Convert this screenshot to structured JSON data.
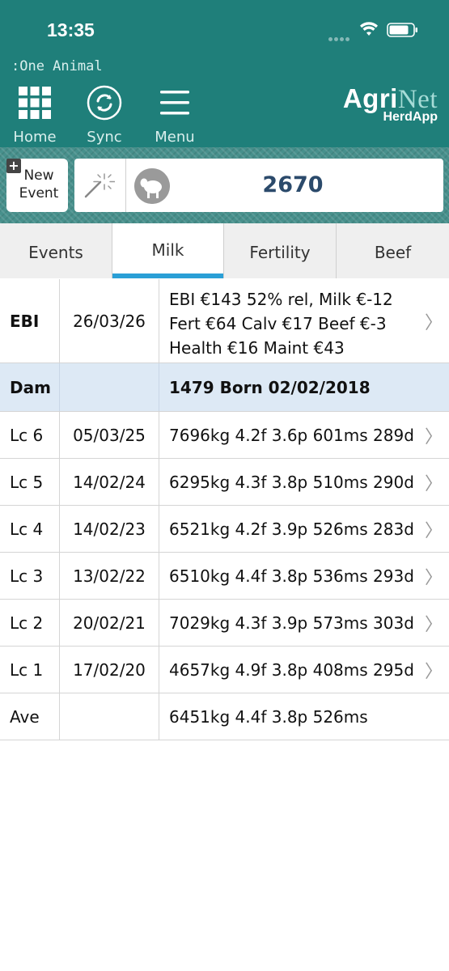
{
  "status": {
    "time": "13:35"
  },
  "screen_label": ":One Animal",
  "nav": {
    "home": "Home",
    "sync": "Sync",
    "menu": "Menu"
  },
  "brand": {
    "name_a": "Agri",
    "name_b": "Net",
    "sub": "HerdApp"
  },
  "toolbar": {
    "new_event_line1": "New",
    "new_event_line2": "Event",
    "animal_id": "2670"
  },
  "tabs": [
    "Events",
    "Milk",
    "Fertility",
    "Beef"
  ],
  "active_tab": "Milk",
  "colors": {
    "header": "#1f7f7a",
    "tab_indicator": "#2a9fd6",
    "dam_row": "#dde9f5",
    "animal_id": "#2b4a6b"
  },
  "ebi": {
    "label": "EBI",
    "date": "26/03/26",
    "line1": "EBI €143 52% rel, Milk €-12",
    "line2": "Fert €64 Calv €17 Beef €-3",
    "line3": "Health €16 Maint €43"
  },
  "dam": {
    "label": "Dam",
    "info": "1479 Born 02/02/2018"
  },
  "lactations": [
    {
      "label": "Lc 6",
      "date": "05/03/25",
      "summary": "7696kg 4.2f 3.6p 601ms 289d"
    },
    {
      "label": "Lc 5",
      "date": "14/02/24",
      "summary": "6295kg 4.3f 3.8p 510ms 290d"
    },
    {
      "label": "Lc 4",
      "date": "14/02/23",
      "summary": "6521kg 4.2f 3.9p 526ms 283d"
    },
    {
      "label": "Lc 3",
      "date": "13/02/22",
      "summary": "6510kg 4.4f 3.8p 536ms 293d"
    },
    {
      "label": "Lc 2",
      "date": "20/02/21",
      "summary": "7029kg 4.3f 3.9p 573ms 303d"
    },
    {
      "label": "Lc 1",
      "date": "17/02/20",
      "summary": "4657kg 4.9f 3.8p 408ms 295d"
    }
  ],
  "average": {
    "label": "Ave",
    "summary": "6451kg 4.4f 3.8p 526ms"
  },
  "chevron": "〉"
}
